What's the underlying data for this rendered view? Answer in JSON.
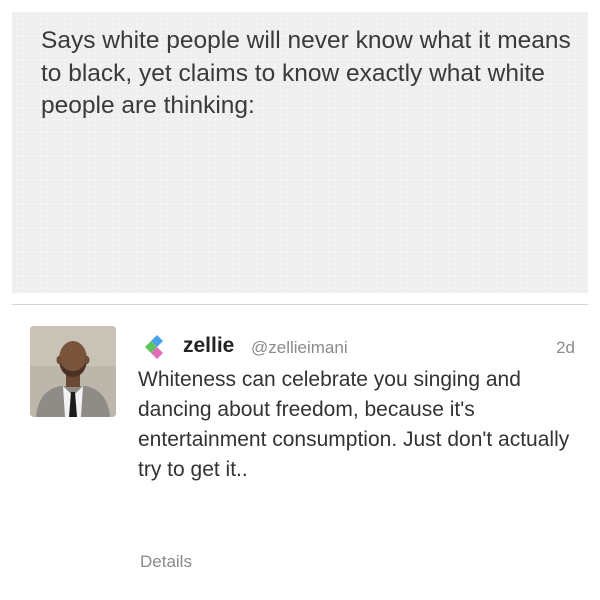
{
  "caption": {
    "text": "Says white people will never know what it means to black, yet claims to know exactly what white people are thinking:"
  },
  "tweet": {
    "app_icon": "colored-diamonds-icon",
    "display_name": "zellie",
    "screen_name": "@zellieimani",
    "timestamp": "2d",
    "body": "Whiteness can celebrate you singing and dancing about freedom, because it's entertainment consumption. Just don't actually try to get it..",
    "details_label": "Details"
  },
  "colors": {
    "caption_background": "#f0f0f0",
    "caption_text": "#3a3a3a",
    "tweet_text": "#333333",
    "muted_text": "#8a8a8a",
    "divider": "#d4d4d4",
    "icon_blue": "#4aa3e8",
    "icon_green": "#5fc35a",
    "icon_pink": "#e06bb8"
  }
}
